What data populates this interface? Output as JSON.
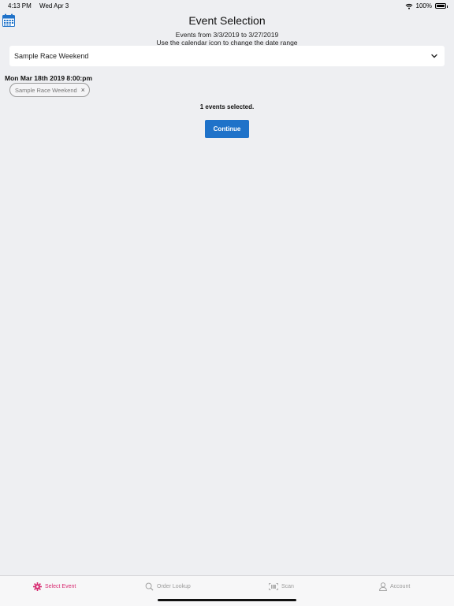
{
  "status_bar": {
    "time": "4:13 PM",
    "date": "Wed Apr 3",
    "battery": "100%",
    "battery_level": 1.0
  },
  "header": {
    "title": "Event Selection",
    "range_text": "Events from 3/3/2019 to 3/27/2019",
    "hint_text": "Use the calendar icon to change the date range"
  },
  "event_select": {
    "value": "Sample Race Weekend"
  },
  "selected_event": {
    "date": "Mon Mar 18th 2019 8:00:pm",
    "chip_label": "Sample Race Weekend",
    "remove_glyph": "×"
  },
  "selection_summary": "1 events selected.",
  "continue_label": "Continue",
  "colors": {
    "accent": "#1f72c9",
    "active_tab": "#d7286f",
    "background": "#eeeff2"
  },
  "tabs": [
    {
      "label": "Select Event",
      "icon": "gear-icon",
      "active": true
    },
    {
      "label": "Order Lookup",
      "icon": "search-icon",
      "active": false
    },
    {
      "label": "Scan",
      "icon": "barcode-icon",
      "active": false
    },
    {
      "label": "Account",
      "icon": "user-icon",
      "active": false
    }
  ]
}
